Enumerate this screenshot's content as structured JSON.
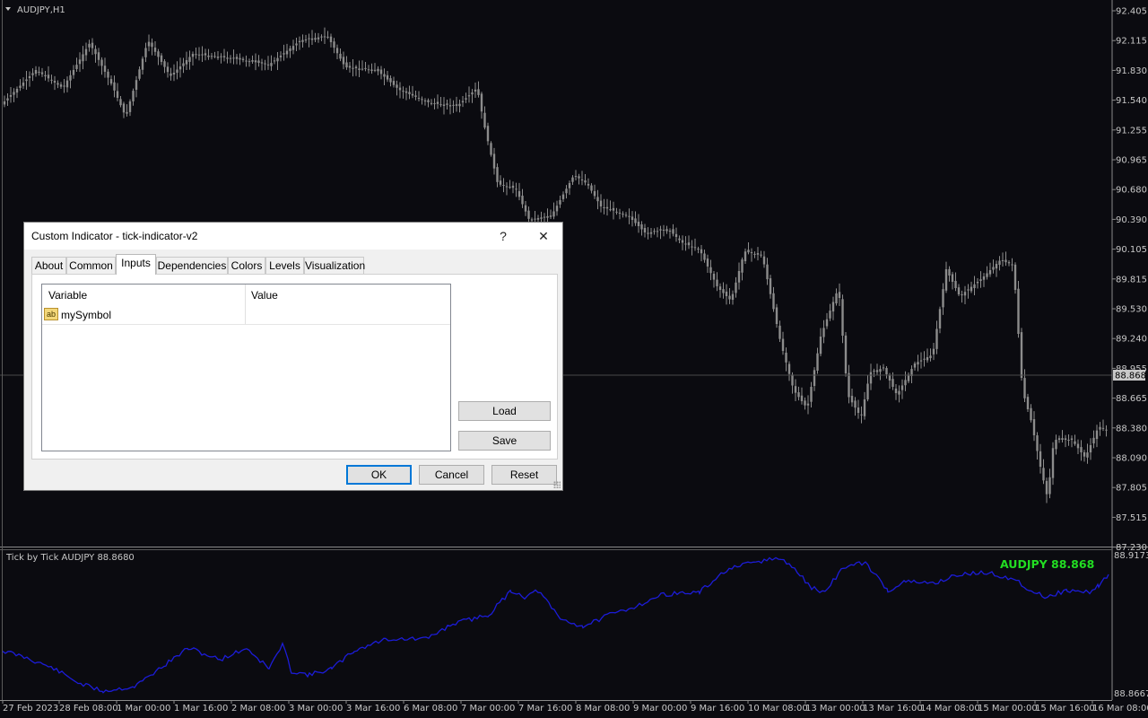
{
  "chart": {
    "symbol_label": "AUDJPY,H1",
    "price_axis": [
      "92.405",
      "92.115",
      "91.830",
      "91.540",
      "91.255",
      "90.965",
      "90.680",
      "90.390",
      "90.105",
      "89.815",
      "89.530",
      "89.240",
      "88.955",
      "88.665",
      "88.380",
      "88.090",
      "87.805",
      "87.515",
      "87.230"
    ],
    "current_price": "88.868",
    "time_axis": [
      "27 Feb 2023",
      "28 Feb 08:00",
      "1 Mar 00:00",
      "1 Mar 16:00",
      "2 Mar 08:00",
      "3 Mar 00:00",
      "3 Mar 16:00",
      "6 Mar 08:00",
      "7 Mar 00:00",
      "7 Mar 16:00",
      "8 Mar 08:00",
      "9 Mar 00:00",
      "9 Mar 16:00",
      "10 Mar 08:00",
      "13 Mar 00:00",
      "13 Mar 16:00",
      "14 Mar 08:00",
      "15 Mar 00:00",
      "15 Mar 16:00",
      "16 Mar 08:00"
    ],
    "colors": {
      "background": "#0b0b10",
      "candle": "#8c8c8c",
      "tick_line": "#1c1cd8",
      "tick_label": "#22dd22"
    }
  },
  "sub_window": {
    "label": "Tick by Tick AUDJPY 88.8680",
    "tick_label": "AUDJPY 88.868",
    "axis_max": "88.9173",
    "axis_min": "88.8667"
  },
  "dialog": {
    "title": "Custom Indicator - tick-indicator-v2",
    "help_label": "?",
    "close_label": "✕",
    "tabs": [
      "About",
      "Common",
      "Inputs",
      "Dependencies",
      "Colors",
      "Levels",
      "Visualization"
    ],
    "active_tab": "Inputs",
    "table": {
      "col_variable": "Variable",
      "col_value": "Value",
      "rows": [
        {
          "icon": "ab",
          "variable": "mySymbol",
          "value": ""
        }
      ]
    },
    "buttons": {
      "load": "Load",
      "save": "Save",
      "ok": "OK",
      "cancel": "Cancel",
      "reset": "Reset"
    }
  }
}
